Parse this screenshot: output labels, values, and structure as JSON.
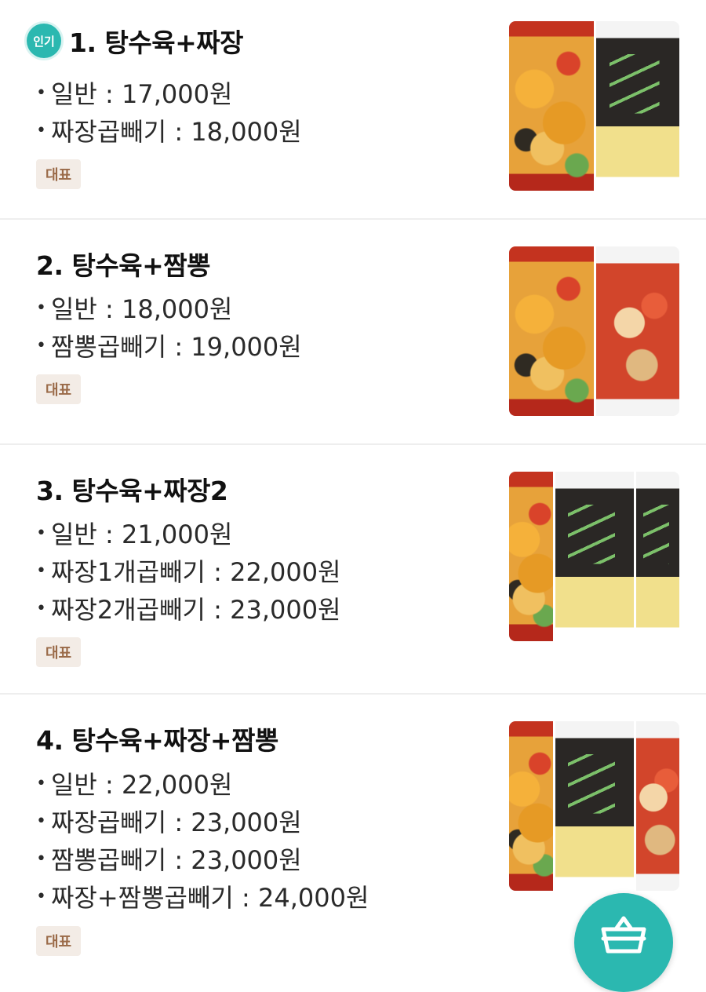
{
  "menu": {
    "items": [
      {
        "badge": "인기",
        "title": "1. 탕수육+짜장",
        "options": [
          "일반 : 17,000원",
          "짜장곱빼기 : 18,000원"
        ],
        "tag": "대표",
        "image_icons": [
          "tangsuyuk-photo",
          "jjajang-photo"
        ]
      },
      {
        "title": "2. 탕수육+짬뽕",
        "options": [
          "일반 : 18,000원",
          "짬뽕곱빼기 : 19,000원"
        ],
        "tag": "대표",
        "image_icons": [
          "tangsuyuk-photo",
          "jjamppong-photo"
        ]
      },
      {
        "title": "3. 탕수육+짜장2",
        "options": [
          "일반 : 21,000원",
          "짜장1개곱빼기 : 22,000원",
          "짜장2개곱빼기 : 23,000원"
        ],
        "tag": "대표",
        "image_icons": [
          "tangsuyuk-photo",
          "jjajang-photo",
          "jjajang-photo"
        ]
      },
      {
        "title": "4. 탕수육+짜장+짬뽕",
        "options": [
          "일반 : 22,000원",
          "짜장곱빼기 : 23,000원",
          "짬뽕곱빼기 : 23,000원",
          "짜장+짬뽕곱빼기 : 24,000원"
        ],
        "tag": "대표",
        "image_icons": [
          "tangsuyuk-photo",
          "jjajang-photo",
          "jjamppong-photo"
        ]
      }
    ]
  },
  "bullet": "•",
  "cart": {
    "icon": "basket-icon"
  },
  "colors": {
    "accent": "#2bb8b0",
    "tag_bg": "#f3ece6",
    "tag_text": "#9a6a48",
    "divider": "#eeeeee"
  }
}
